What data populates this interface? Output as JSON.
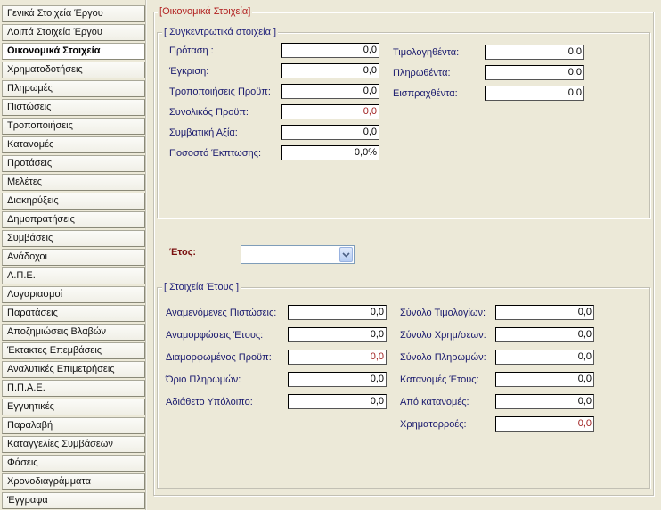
{
  "sidebar": {
    "items": [
      {
        "label": "Γενικά Στοιχεία Έργου"
      },
      {
        "label": "Λοιπά Στοιχεία Έργου"
      },
      {
        "label": "Οικονομικά Στοιχεία"
      },
      {
        "label": "Χρηματοδοτήσεις"
      },
      {
        "label": "Πληρωμές"
      },
      {
        "label": "Πιστώσεις"
      },
      {
        "label": "Τροποποιήσεις"
      },
      {
        "label": "Κατανομές"
      },
      {
        "label": "Προτάσεις"
      },
      {
        "label": "Μελέτες"
      },
      {
        "label": "Διακηρύξεις"
      },
      {
        "label": "Δημοπρατήσεις"
      },
      {
        "label": "Συμβάσεις"
      },
      {
        "label": "Ανάδοχοι"
      },
      {
        "label": "Α.Π.Ε."
      },
      {
        "label": "Λογαριασμοί"
      },
      {
        "label": "Παρατάσεις"
      },
      {
        "label": "Αποζημιώσεις Βλαβών"
      },
      {
        "label": "Έκτακτες Επεμβάσεις"
      },
      {
        "label": "Αναλυτικές Επιμετρήσεις"
      },
      {
        "label": "Π.Π.Α.Ε."
      },
      {
        "label": "Εγγυητικές"
      },
      {
        "label": "Παραλαβή"
      },
      {
        "label": "Καταγγελίες Συμβάσεων"
      },
      {
        "label": "Φάσεις"
      },
      {
        "label": "Χρονοδιαγράμματα"
      },
      {
        "label": "Έγγραφα"
      }
    ]
  },
  "main": {
    "title": "Οικονομικά Στοιχεία",
    "summary": {
      "title": "[ Συγκεντρωτικά στοιχεία ]",
      "left": [
        {
          "label": "Πρόταση :",
          "value": "0,0"
        },
        {
          "label": "Έγκριση:",
          "value": "0,0"
        },
        {
          "label": "Τροποποιήσεις Προϋπ:",
          "value": "0,0"
        },
        {
          "label": "Συνολικός Προϋπ:",
          "value": "0,0"
        },
        {
          "label": "Συμβατική Αξία:",
          "value": "0,0"
        },
        {
          "label": "Ποσοστό Έκπτωσης:",
          "value": "0,0%"
        }
      ],
      "right": [
        {
          "label": "Τιμολογηθέντα:",
          "value": "0,0"
        },
        {
          "label": "Πληρωθέντα:",
          "value": "0,0"
        },
        {
          "label": "Εισπραχθέντα:",
          "value": "0,0"
        }
      ]
    },
    "year": {
      "label": "Έτος:",
      "value": ""
    },
    "year_details": {
      "title": "[ Στοιχεία Έτους ]",
      "left": [
        {
          "label": "Αναμενόμενες Πιστώσεις:",
          "value": "0,0"
        },
        {
          "label": "Αναμορφώσεις Έτους:",
          "value": "0,0"
        },
        {
          "label": "Διαμορφωμένος Προϋπ:",
          "value": "0,0"
        },
        {
          "label": "Όριο Πληρωμών:",
          "value": "0,0"
        },
        {
          "label": "Αδιάθετο Υπόλοιπο:",
          "value": "0,0"
        }
      ],
      "right": [
        {
          "label": "Σύνολο Τιμολογίων:",
          "value": "0,0"
        },
        {
          "label": "Σύνολο Χρημ/σεων:",
          "value": "0,0"
        },
        {
          "label": "Σύνολο Πληρωμών:",
          "value": "0,0"
        },
        {
          "label": "Κατανομές Έτους:",
          "value": "0,0"
        },
        {
          "label": "Από κατανομές:",
          "value": "0,0"
        },
        {
          "label": "Χρηματορροές:",
          "value": "0,0"
        }
      ]
    }
  }
}
